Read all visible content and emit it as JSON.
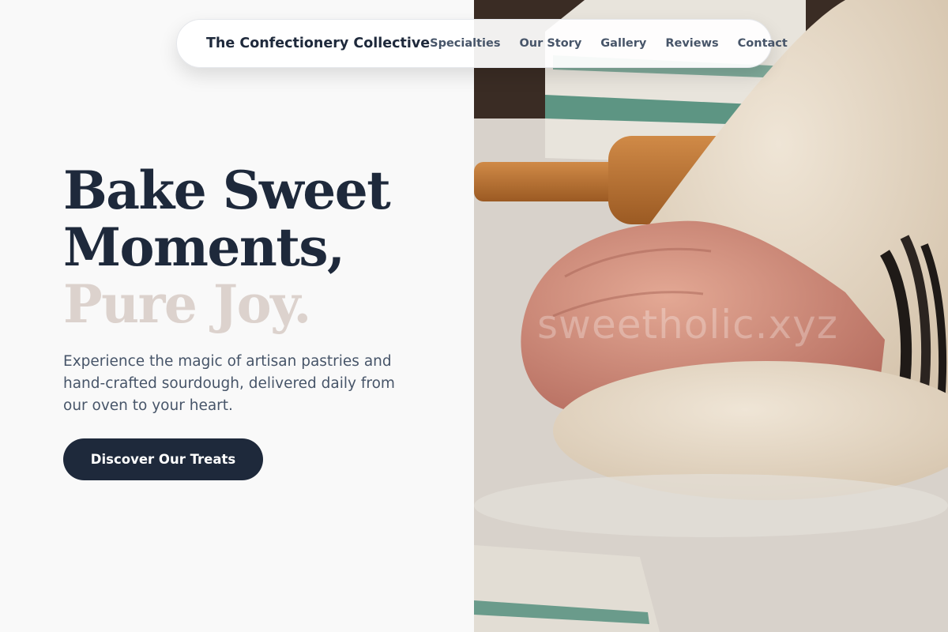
{
  "nav": {
    "brand": "The Confectionery Collective",
    "links": [
      "Specialties",
      "Our Story",
      "Gallery",
      "Reviews",
      "Contact"
    ]
  },
  "hero": {
    "headline_line1": "Bake Sweet",
    "headline_line2": "Moments,",
    "headline_line3": "Pure Joy.",
    "subtext": "Experience the magic of artisan pastries and hand-crafted sourdough, delivered daily from our oven to your heart.",
    "cta_label": "Discover Our Treats"
  },
  "image": {
    "watermark": "sweetholic.xyz"
  },
  "colors": {
    "primary": "#1e293b",
    "accent_soft": "#dcd2cd",
    "body_text": "#475569",
    "background": "#f9f9f9"
  }
}
